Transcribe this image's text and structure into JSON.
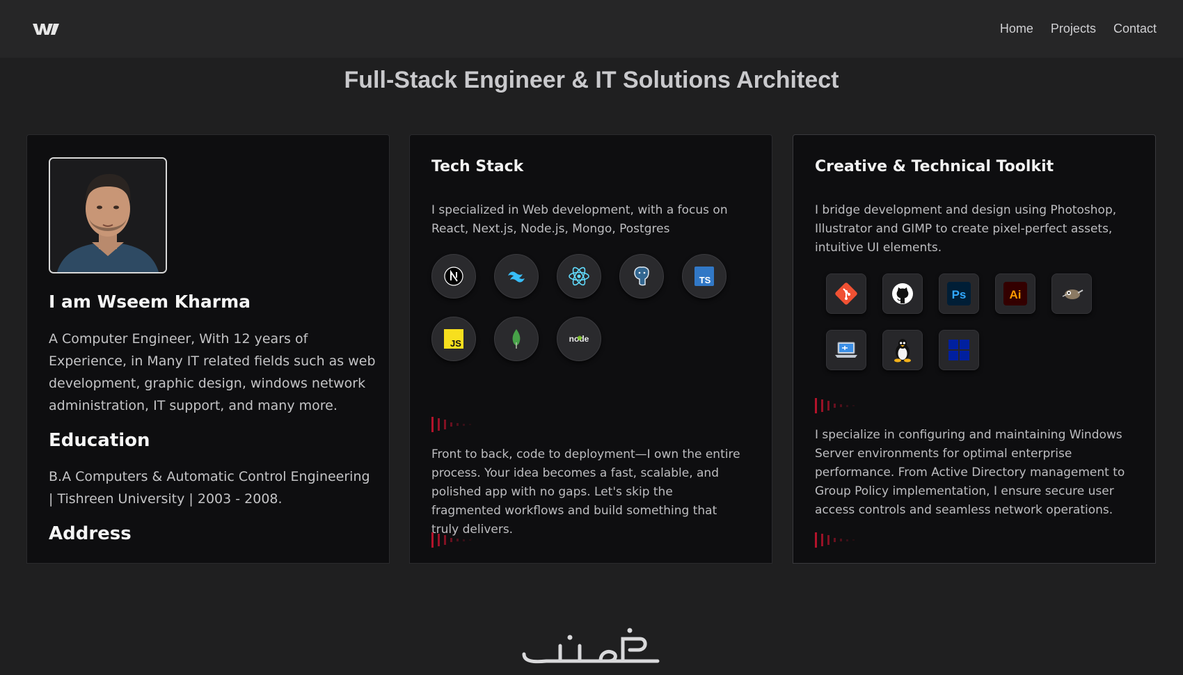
{
  "nav": {
    "logo": "W",
    "links": [
      "Home",
      "Projects",
      "Contact"
    ]
  },
  "headline": "Full-Stack Engineer & IT Solutions Architect",
  "profile": {
    "name": "I am Wseem Kharma",
    "bio": "A Computer Engineer, With 12 years of Experience, in Many IT related fields such as web development, graphic design, windows network administration, IT support, and many more.",
    "education_heading": "Education",
    "education": "B.A Computers & Automatic Control Engineering | Tishreen University | 2003 - 2008.",
    "address_heading": "Address"
  },
  "tech_stack": {
    "title": "Tech Stack",
    "description": "I specialized in Web development, with a focus on React, Next.js, Node.js, Mongo, Postgres",
    "icons": [
      "nextjs-icon",
      "tailwind-icon",
      "react-icon",
      "postgres-icon",
      "typescript-icon",
      "javascript-icon",
      "mongodb-icon",
      "nodejs-icon"
    ],
    "icon_text": {
      "typescript": "TS",
      "javascript": "JS",
      "node": "node"
    },
    "body": "Front to back, code to deployment—I own the entire process. Your idea becomes a fast, scalable, and polished app with no gaps. Let's skip the fragmented workflows and build something that truly delivers."
  },
  "toolkit": {
    "title": "Creative & Technical Toolkit",
    "description": "I bridge development and design using Photoshop, Illustrator and GIMP to create pixel-perfect assets, intuitive UI elements.",
    "icons": [
      "git-icon",
      "github-icon",
      "photoshop-icon",
      "illustrator-icon",
      "gimp-icon",
      "laptop-icon",
      "linux-icon",
      "windows-icon"
    ],
    "icon_text": {
      "photoshop": "Ps",
      "illustrator": "Ai"
    },
    "body": "I specialize in configuring and maintaining Windows Server environments for optimal enterprise performance. From Active Directory management to Group Policy implementation, I ensure secure user access controls and seamless network operations."
  },
  "colors": {
    "background": "#1f1f20",
    "card": "#0e0e10",
    "accent": "#b3132b"
  }
}
